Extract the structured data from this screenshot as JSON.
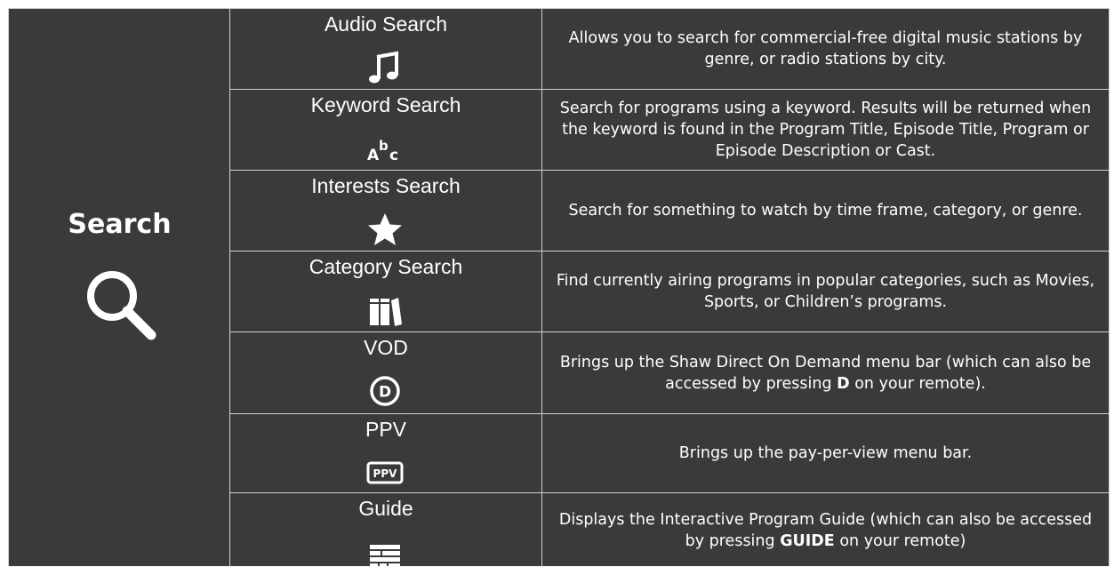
{
  "section": {
    "title": "Search",
    "icon": "search-icon"
  },
  "rows": [
    {
      "name": "Audio Search",
      "icon": "music-note-icon",
      "description": "Allows you to search for commercial-free digital music stations by genre, or radio stations by city."
    },
    {
      "name": "Keyword Search",
      "icon": "abc-text-icon",
      "icon_text": "Abc",
      "description": "Search for programs using a keyword. Results will be returned when the keyword is found in the Program Title, Episode Title, Program or Episode Description or Cast."
    },
    {
      "name": "Interests Search",
      "icon": "star-icon",
      "description": "Search for something to watch by time frame, category, or genre."
    },
    {
      "name": "Category Search",
      "icon": "books-icon",
      "description": "Find currently airing programs in popular categories, such as Movies, Sports, or Children’s programs."
    },
    {
      "name": "VOD",
      "icon": "vod-d-icon",
      "icon_text": "D",
      "description_before": "Brings up the Shaw Direct On Demand menu bar (which can also be accessed by pressing ",
      "description_bold": "D",
      "description_after": " on your remote)."
    },
    {
      "name": "PPV",
      "icon": "ppv-badge-icon",
      "icon_text": "PPV",
      "description": "Brings up the pay-per-view menu bar."
    },
    {
      "name": "Guide",
      "icon": "guide-grid-icon",
      "description_before": "Displays the Interactive Program Guide (which can also be accessed by pressing ",
      "description_bold": "GUIDE",
      "description_after": " on your remote)"
    }
  ]
}
